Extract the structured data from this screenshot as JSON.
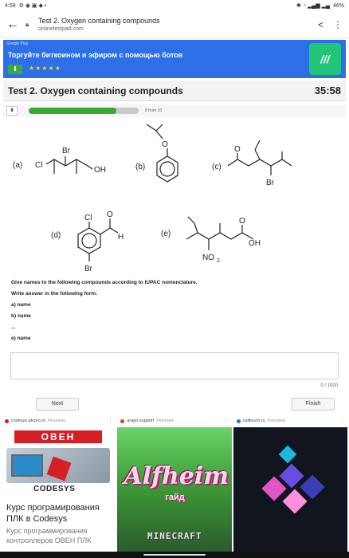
{
  "status_bar": {
    "time": "4:58",
    "battery": "46%"
  },
  "browser": {
    "page_title": "Test 2. Oxygen containing compounds",
    "url": "onlinetestpad.com"
  },
  "top_ad": {
    "badge": "Google Play",
    "headline": "Торгуйте биткоином и эфиром с помощью ботов",
    "stars": "★★★★★",
    "app_icon_text": "///"
  },
  "test": {
    "title": "Test 2. Oxygen containing compounds",
    "timer": "35:58",
    "question_number": "8",
    "progress_text": "8 from 10",
    "progress_fraction": 0.8
  },
  "molecules": {
    "a": {
      "label": "(a)",
      "atoms": [
        "Br",
        "Cl",
        "OH"
      ]
    },
    "b": {
      "label": "(b)",
      "atoms": [
        "O"
      ]
    },
    "c": {
      "label": "(c)",
      "atoms": [
        "O",
        "Br"
      ]
    },
    "d": {
      "label": "(d)",
      "atoms": [
        "Cl",
        "O",
        "H",
        "Br"
      ]
    },
    "e": {
      "label": "(e)",
      "atoms": [
        "O",
        "OH",
        "NO",
        "2"
      ]
    }
  },
  "instructions": {
    "line1": "Give names to the following compounds according to IUPAC nomenclature.",
    "line2": "Write answer in the following form:",
    "line3": "a) name",
    "line4": "b) name",
    "line5": "...",
    "line6": "e) name"
  },
  "answer": {
    "value": "",
    "char_count": "0 / 1000"
  },
  "buttons": {
    "next": "Next",
    "finish": "Finish"
  },
  "bottom_ads": [
    {
      "source": "codesys.plcpro.ru",
      "tag": "Реклама",
      "brand": "ОВЕН",
      "product": "CODESYS",
      "headline": "Курс програмирования ПЛК в Codesys",
      "subtitle": "Курс программирования контроллеров ОВЕН ПЛК"
    },
    {
      "source": "arago.support",
      "tag": "Реклама",
      "logo": "Alfheim",
      "logo_sub": "гайд",
      "footer": "MINECRAFT"
    },
    {
      "source": "calltouch.ru",
      "tag": "Реклама"
    }
  ],
  "colors": {
    "ad_blue": "#2d6fe6",
    "progress_green": "#3aa832",
    "codesys_red": "#d41f27"
  }
}
